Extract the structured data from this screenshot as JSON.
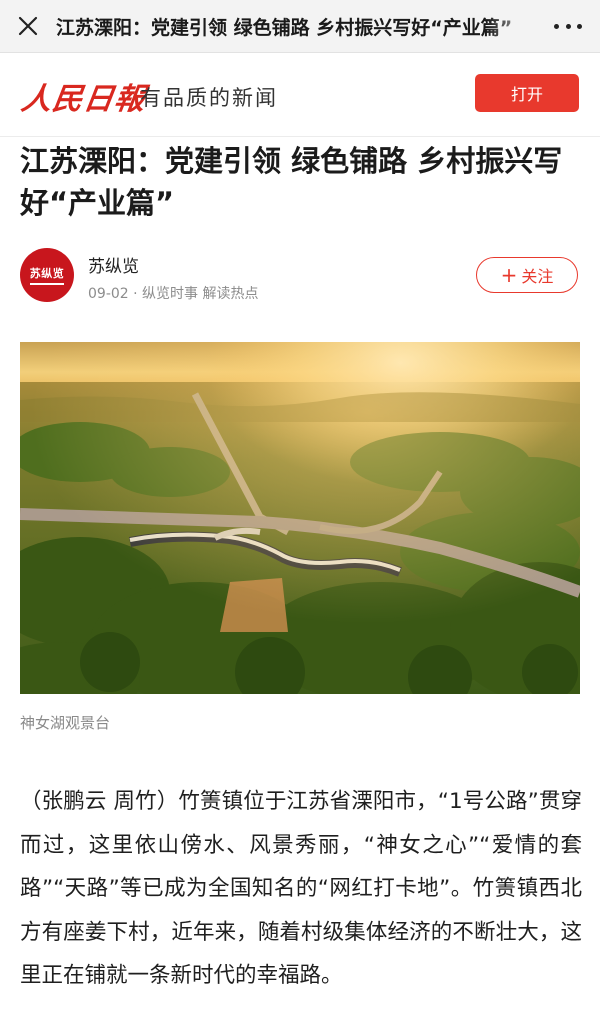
{
  "topbar": {
    "close_icon": "close-icon",
    "title": "江苏溧阳：党建引领 绿色铺路 乡村振兴写好“产业篇”",
    "more_icon": "more-icon"
  },
  "brand": {
    "logo_text": "人民日報",
    "slogan": "有品质的新闻",
    "open_label": "打开",
    "accent_color": "#e8392d"
  },
  "article": {
    "headline": "江苏溧阳：党建引领 绿色铺路 乡村振兴写好“产业篇”",
    "author": {
      "avatar_text": "苏纵览",
      "name": "苏纵览",
      "meta": "09-02 · 纵览时事 解读热点",
      "follow_label": "关注",
      "follow_icon": "plus-icon"
    },
    "image": {
      "caption": "神女湖观景台"
    },
    "body": "（张鹏云 周竹）竹箦镇位于江苏省溧阳市，“1号公路”贯穿而过，这里依山傍水、风景秀丽，“神女之心”“爱情的套路”“天路”等已成为全国知名的“网红打卡地”。竹箦镇西北方有座姜下村，近年来，随着村级集体经济的不断壮大，这里正在铺就一条新时代的幸福路。"
  }
}
